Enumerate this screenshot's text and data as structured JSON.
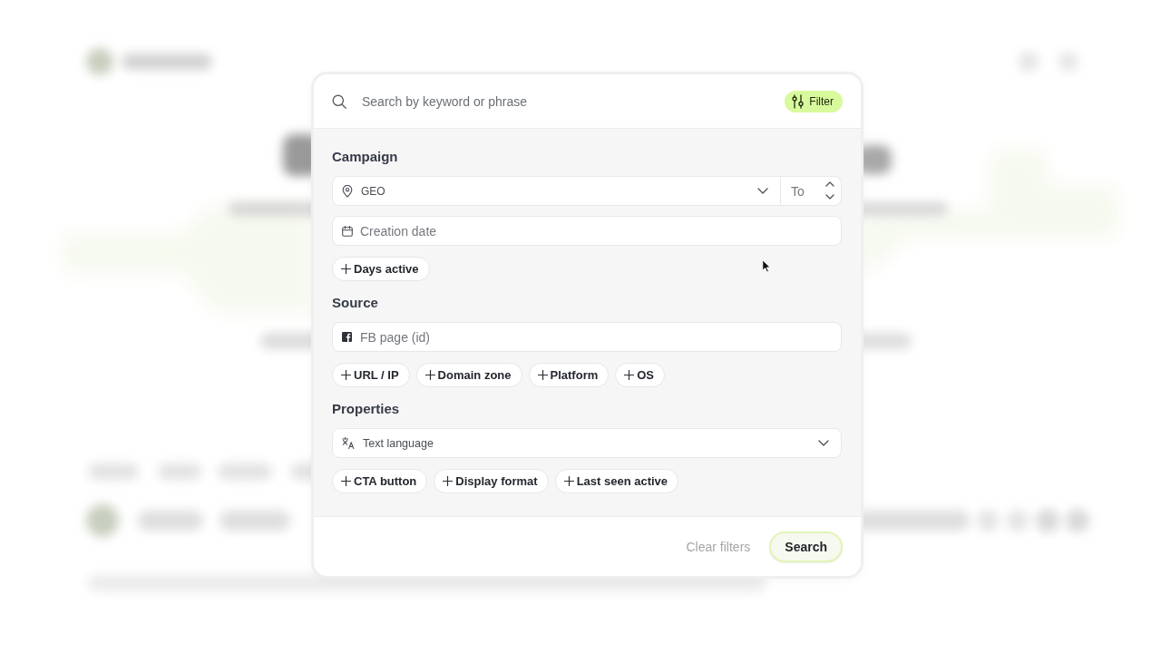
{
  "search": {
    "placeholder": "Search by keyword or phrase"
  },
  "filter_button": {
    "label": "Filter"
  },
  "sections": [
    {
      "title": "Campaign",
      "fields": [
        {
          "kind": "geo",
          "label": "GEO",
          "range_placeholder": "To"
        },
        {
          "kind": "date",
          "placeholder": "Creation date"
        }
      ],
      "chips": [
        "Days active"
      ]
    },
    {
      "title": "Source",
      "fields": [
        {
          "kind": "page",
          "placeholder": "FB page (id)"
        }
      ],
      "chips": [
        "URL / IP",
        "Domain zone",
        "Platform",
        "OS"
      ]
    },
    {
      "title": "Properties",
      "fields": [
        {
          "kind": "language",
          "label": "Text language"
        }
      ],
      "chips": [
        "CTA button",
        "Display format",
        "Last seen active"
      ]
    }
  ],
  "footer": {
    "clear_button": {
      "label": "Clear filters",
      "disabled": true
    },
    "submit_button": {
      "label": "Search"
    }
  }
}
